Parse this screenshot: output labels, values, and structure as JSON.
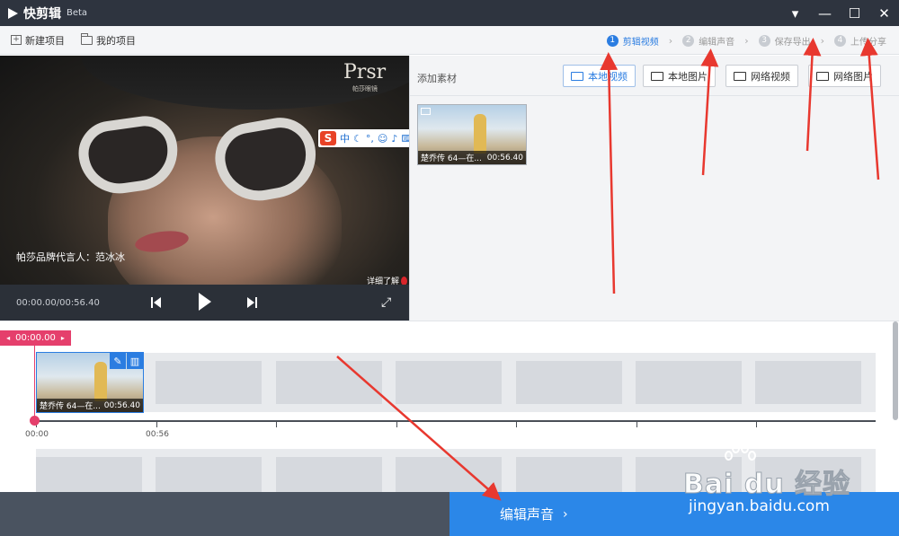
{
  "app": {
    "name": "快剪辑",
    "tag": "Beta"
  },
  "window_controls": [
    "menu-icon",
    "minimize-icon",
    "maximize-icon",
    "close-icon"
  ],
  "toolbar": {
    "new_project": "新建项目",
    "my_projects": "我的项目"
  },
  "steps": [
    {
      "num": "1",
      "label": "剪辑视频",
      "active": true
    },
    {
      "num": "2",
      "label": "编辑声音",
      "active": false
    },
    {
      "num": "3",
      "label": "保存导出",
      "active": false
    },
    {
      "num": "4",
      "label": "上传分享",
      "active": false
    }
  ],
  "preview": {
    "brand": "Prsr",
    "brand_sub": "帕莎眼镜",
    "caption": "帕莎品牌代言人：范冰冰",
    "detail_link": "详细了解",
    "timecode": "00:00.00/00:56.40",
    "ime": {
      "logo": "S",
      "mode": "中"
    }
  },
  "media": {
    "title": "添加素材",
    "buttons": {
      "local_video": "本地视频",
      "local_image": "本地图片",
      "web_video": "网络视频",
      "web_image": "网络图片"
    },
    "clip": {
      "name": "楚乔传 64—在...",
      "duration": "00:56.40"
    }
  },
  "timeline": {
    "playhead": "00:00.00",
    "clip": {
      "name": "楚乔传 64—在...",
      "duration": "00:56.40"
    },
    "ticks": [
      "00:00",
      "00:56"
    ]
  },
  "bottom": {
    "next_step": "编辑声音"
  },
  "watermark": {
    "text": "Bai du 经验",
    "url": "jingyan.baidu.com"
  },
  "colors": {
    "accent": "#2b7de1",
    "playhead": "#e53f6c",
    "titlebar": "#2e343f",
    "annotation": "#e8382f"
  }
}
